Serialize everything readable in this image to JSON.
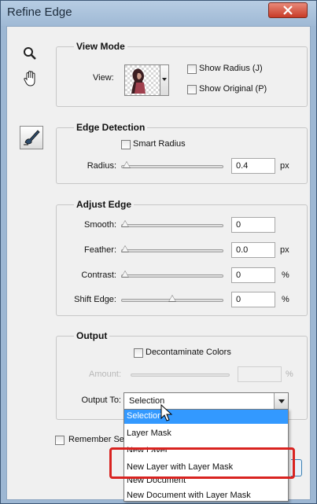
{
  "window": {
    "title": "Refine Edge"
  },
  "view_mode": {
    "title": "View Mode",
    "view_label": "View:",
    "show_radius": "Show Radius (J)",
    "show_original": "Show Original (P)"
  },
  "edge_detection": {
    "title": "Edge Detection",
    "smart_radius": "Smart Radius",
    "radius_label": "Radius:",
    "radius_value": "0.4",
    "radius_unit": "px",
    "radius_level": 0.02
  },
  "adjust_edge": {
    "title": "Adjust Edge",
    "smooth_label": "Smooth:",
    "smooth_value": "0",
    "smooth_level": 0,
    "feather_label": "Feather:",
    "feather_value": "0.0",
    "feather_unit": "px",
    "feather_level": 0,
    "contrast_label": "Contrast:",
    "contrast_value": "0",
    "contrast_unit": "%",
    "contrast_level": 0,
    "shift_label": "Shift Edge:",
    "shift_value": "0",
    "shift_unit": "%",
    "shift_level": 0.5
  },
  "output": {
    "title": "Output",
    "decontaminate": "Decontaminate Colors",
    "amount_label": "Amount:",
    "amount_unit": "%",
    "output_to_label": "Output To:",
    "output_to_value": "Selection",
    "options": [
      "Selection",
      "Layer Mask",
      "New Layer",
      "New Layer with Layer Mask",
      "New Document",
      "New Document with Layer Mask"
    ],
    "selected_index": 0
  },
  "remember": {
    "label": "Remember Se"
  },
  "colors": {
    "highlight": "#d92320",
    "selection": "#3399ff",
    "title_bar": "#9fb9d5"
  }
}
